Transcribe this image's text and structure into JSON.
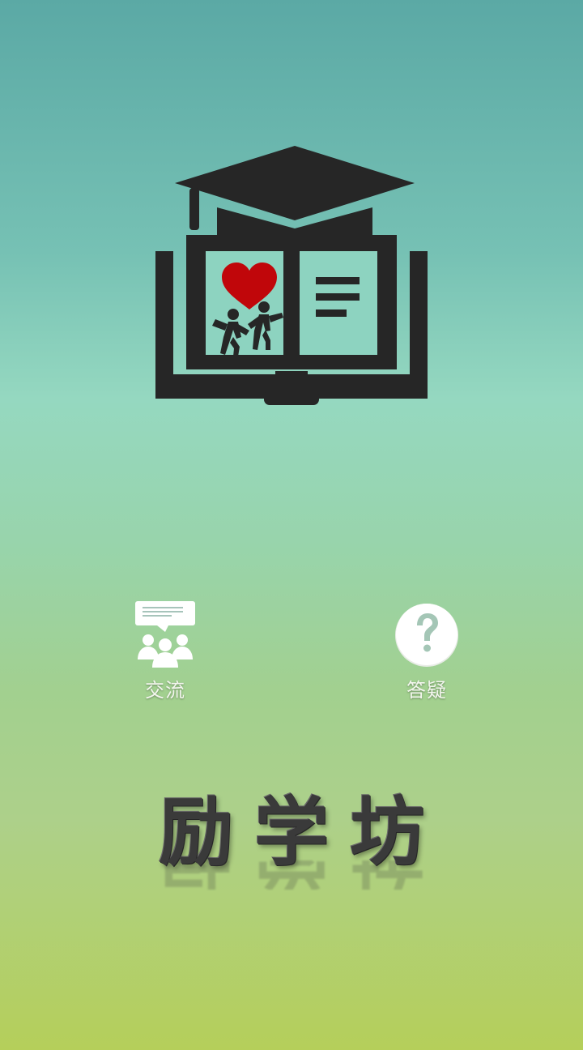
{
  "actions": {
    "chat": {
      "label": "交流",
      "icon": "group-chat-icon"
    },
    "qa": {
      "label": "答疑",
      "icon": "question-icon"
    }
  },
  "brand": {
    "title": "励学坊"
  },
  "logo": {
    "icon": "graduation-book-icon"
  },
  "colors": {
    "background_top": "#5ba9a5",
    "background_mid": "#95d8c0",
    "background_bottom": "#b5cf5a",
    "logo_dark": "#262626",
    "heart": "#c0060a",
    "icon_white": "#ffffff",
    "brand_text": "#3a3a3a"
  }
}
